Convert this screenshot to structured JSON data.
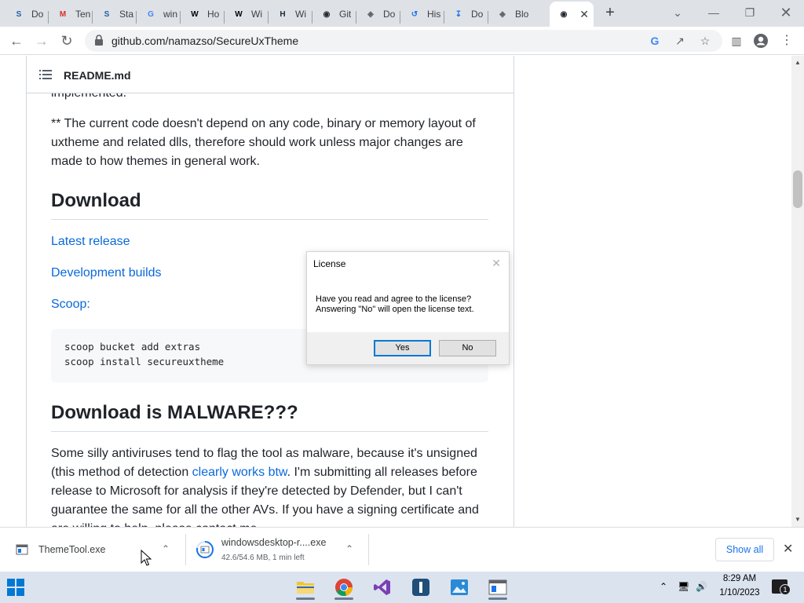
{
  "browser": {
    "tabs": [
      {
        "title": "Do",
        "icon": "stack-overflow-icon",
        "color": "#1f5fa3"
      },
      {
        "title": "Ten",
        "icon": "gmail-icon",
        "color": "#d93025"
      },
      {
        "title": "Sta",
        "icon": "stack-overflow-icon",
        "color": "#1f5fa3"
      },
      {
        "title": "win",
        "icon": "google-icon",
        "color": "#4285f4"
      },
      {
        "title": "Ho",
        "icon": "wikihow-icon",
        "color": "#000000"
      },
      {
        "title": "Wi",
        "icon": "wikihow-icon",
        "color": "#000000"
      },
      {
        "title": "Wi",
        "icon": "heading-icon",
        "color": "#1e2a3a"
      },
      {
        "title": "Git",
        "icon": "github-icon",
        "color": "#24292f"
      },
      {
        "title": "Do",
        "icon": "globe-icon",
        "color": "#5f6368"
      },
      {
        "title": "His",
        "icon": "history-icon",
        "color": "#1a73e8"
      },
      {
        "title": "Do",
        "icon": "download-icon",
        "color": "#1a73e8"
      },
      {
        "title": "Blo",
        "icon": "globe-icon",
        "color": "#5f6368"
      },
      {
        "title": "",
        "icon": "github-icon",
        "color": "#24292f",
        "active": true
      }
    ],
    "new_tab": "+",
    "url": "github.com/namazso/SecureUxTheme"
  },
  "readme": {
    "filename": "README.md",
    "partial_line": "implemented.",
    "note": "** The current code doesn't depend on any code, binary or memory layout of uxtheme and related dlls, therefore should work unless major changes are made to how themes in general work.",
    "download_heading": "Download",
    "links": [
      "Latest release",
      "Development builds",
      "Scoop:"
    ],
    "code": [
      "scoop bucket add extras",
      "scoop install secureuxtheme"
    ],
    "malware_heading": "Download is MALWARE???",
    "malware_text_1": "Some silly antiviruses tend to flag the tool as malware, because it's unsigned (this method of detection ",
    "malware_link": "clearly works btw",
    "malware_text_2": ". I'm submitting all releases before release to Microsoft for analysis if they're detected by Defender, but I can't guarantee the same for all the other AVs. If you have a signing certificate and are willing to help, please contact me."
  },
  "dialog": {
    "title": "License",
    "line1": "Have you read and agree to the license?",
    "line2": "Answering \"No\" will open the license text.",
    "yes": "Yes",
    "no": "No"
  },
  "downloads": {
    "items": [
      {
        "name": "ThemeTool.exe",
        "status": ""
      },
      {
        "name": "windowsdesktop-r....exe",
        "status": "42.6/54.6 MB, 1 min left",
        "progress": 0.78
      }
    ],
    "show_all": "Show all"
  },
  "taskbar": {
    "time": "8:29 AM",
    "date": "1/10/2023",
    "notifications": "1"
  }
}
